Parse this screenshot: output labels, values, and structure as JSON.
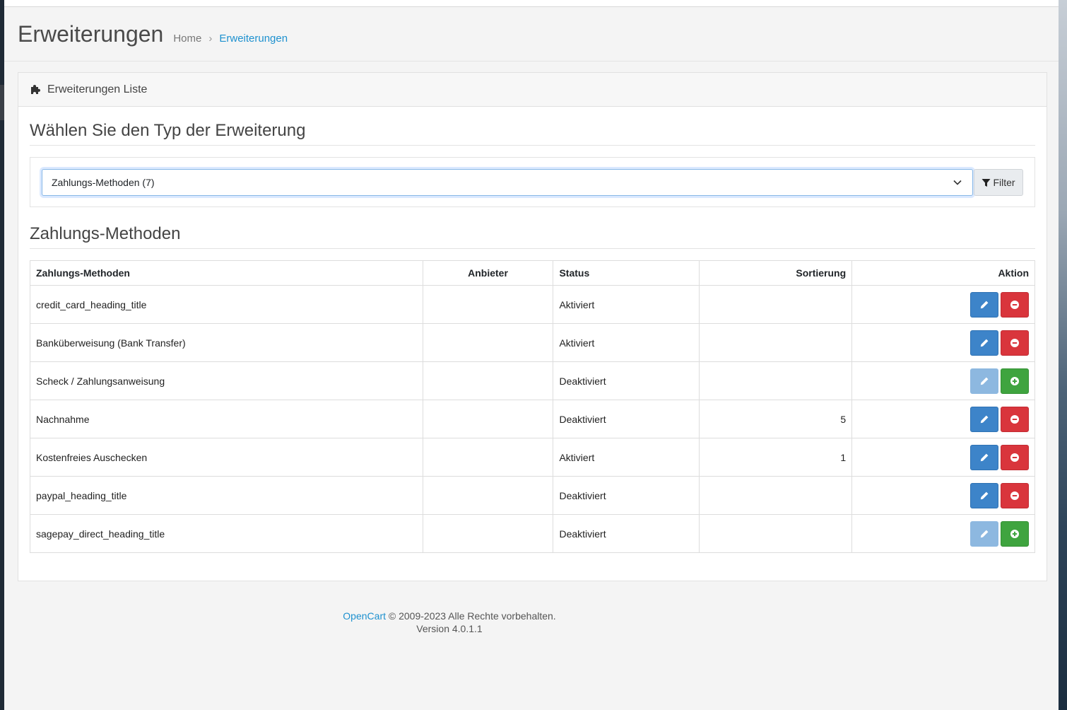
{
  "header": {
    "title": "Erweiterungen",
    "breadcrumb": [
      {
        "label": "Home"
      },
      {
        "label": "Erweiterungen"
      }
    ]
  },
  "card": {
    "title": "Erweiterungen Liste",
    "type_legend": "Wählen Sie den Typ der Erweiterung",
    "type_select_value": "Zahlungs-Methoden (7)",
    "filter_label": "Filter",
    "section_legend": "Zahlungs-Methoden"
  },
  "table": {
    "columns": [
      "Zahlungs-Methoden",
      "Anbieter",
      "Status",
      "Sortierung",
      "Aktion"
    ],
    "rows": [
      {
        "name": "credit_card_heading_title",
        "vendor": "",
        "status": "Aktiviert",
        "sort": "",
        "installed": true
      },
      {
        "name": "Banküberweisung (Bank Transfer)",
        "vendor": "",
        "status": "Aktiviert",
        "sort": "",
        "installed": true
      },
      {
        "name": "Scheck / Zahlungsanweisung",
        "vendor": "",
        "status": "Deaktiviert",
        "sort": "",
        "installed": false
      },
      {
        "name": "Nachnahme",
        "vendor": "",
        "status": "Deaktiviert",
        "sort": "5",
        "installed": true
      },
      {
        "name": "Kostenfreies Auschecken",
        "vendor": "",
        "status": "Aktiviert",
        "sort": "1",
        "installed": true
      },
      {
        "name": "paypal_heading_title",
        "vendor": "",
        "status": "Deaktiviert",
        "sort": "",
        "installed": true
      },
      {
        "name": "sagepay_direct_heading_title",
        "vendor": "",
        "status": "Deaktiviert",
        "sort": "",
        "installed": false
      }
    ]
  },
  "footer": {
    "brand": "OpenCart",
    "copyright": "© 2009-2023 Alle Rechte vorbehalten.",
    "version": "Version 4.0.1.1"
  },
  "icons": {
    "card_header": "puzzle-piece-icon",
    "filter": "funnel-icon",
    "select": "chevron-down-icon",
    "edit": "pencil-icon",
    "uninstall": "minus-circle-icon",
    "install": "plus-circle-icon"
  },
  "colors": {
    "link": "#1e91cf",
    "edit": "#3d84c9",
    "uninstall": "#d9353c",
    "install": "#3fa43f"
  }
}
